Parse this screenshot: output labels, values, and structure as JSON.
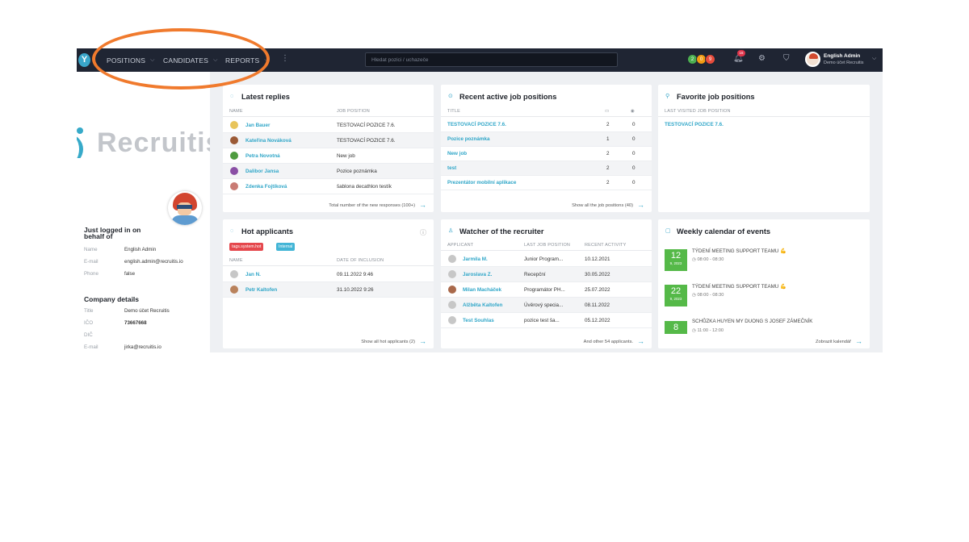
{
  "topbar": {
    "logo": "Y",
    "nav": [
      "POSITIONS",
      "CANDIDATES",
      "REPORTS"
    ],
    "search_placeholder": "Hledat pozici / uchazeče",
    "status_counts": [
      {
        "value": "2",
        "color": "#4caf50"
      },
      {
        "value": "0",
        "color": "#f39c12"
      },
      {
        "value": "9",
        "color": "#e74c3c"
      }
    ],
    "notifications_count": "16",
    "user_name": "English Admin",
    "user_org": "Demo účet Recruitis",
    "icons": [
      "bell-icon",
      "gear-icon",
      "shield-icon"
    ]
  },
  "sidebar": {
    "brand": "Recruitis",
    "login_heading": "Just logged in on behalf of",
    "login_rows": [
      {
        "label": "Name",
        "value": "English Admin"
      },
      {
        "label": "E-mail",
        "value": "english.admin@recruitis.io"
      },
      {
        "label": "Phone",
        "value": "false"
      }
    ],
    "company_heading": "Company details",
    "company_rows": [
      {
        "label": "Title",
        "value": "Demo účet Recruitis"
      },
      {
        "label": "IČO",
        "value": "73667668"
      },
      {
        "label": "DIČ",
        "value": ""
      },
      {
        "label": "E-mail",
        "value": "jirka@recruitis.io"
      }
    ]
  },
  "latest_replies": {
    "title": "Latest replies",
    "col_name": "NAME",
    "col_position": "JOB POSITION",
    "rows": [
      {
        "name": "Jan Bauer",
        "position": "TESTOVACÍ POZICE 7.6.",
        "avatar": "#e8c45a"
      },
      {
        "name": "Kateřina Nováková",
        "position": "TESTOVACÍ POZICE 7.6.",
        "avatar": "#9b5a36"
      },
      {
        "name": "Petra Novotná",
        "position": "New job",
        "avatar": "#4e9b3f"
      },
      {
        "name": "Dalibor Jansa",
        "position": "Pozice poznámka",
        "avatar": "#8a4fa5"
      },
      {
        "name": "Zdenka Fojtíková",
        "position": "šablona decathlon testík",
        "avatar": "#c97b74"
      }
    ],
    "footer": "Total number of the new responses (100+)"
  },
  "recent_positions": {
    "title": "Recent active job positions",
    "col_title": "TITLE",
    "rows": [
      {
        "title": "TESTOVACÍ POZICE 7.6.",
        "a": "2",
        "b": "0"
      },
      {
        "title": "Pozice poznámka",
        "a": "1",
        "b": "0"
      },
      {
        "title": "New job",
        "a": "2",
        "b": "0"
      },
      {
        "title": "test",
        "a": "2",
        "b": "0"
      },
      {
        "title": "Prezentátor mobilní aplikace",
        "a": "2",
        "b": "0"
      }
    ],
    "footer": "Show all the job positions (40)"
  },
  "favorite_positions": {
    "title": "Favorite job positions",
    "col": "LAST VISITED JOB POSITION",
    "rows": [
      "TESTOVACÍ POZICE 7.6."
    ]
  },
  "hot_applicants": {
    "title": "Hot applicants",
    "tags": [
      {
        "label": "tags.system.hot",
        "color": "#e5484d"
      },
      {
        "label": "Internal",
        "color": "#43b5d6"
      }
    ],
    "col_name": "NAME",
    "col_date": "DATE OF INCLUSION",
    "rows": [
      {
        "name": "Jan N.",
        "date": "09.11.2022 9:46",
        "avatar": "#c7c7c7"
      },
      {
        "name": "Petr Kaltofen",
        "date": "31.10.2022 9:26",
        "avatar": "#b9825c"
      }
    ],
    "footer": "Show all hot applicants (2)"
  },
  "watcher": {
    "title": "Watcher of the recruiter",
    "col_applicant": "APPLICANT",
    "col_position": "LAST JOB POSITION",
    "col_activity": "RECENT ACTIVITY",
    "rows": [
      {
        "name": "Jarmila M.",
        "position": "Junior Program...",
        "activity": "10.12.2021",
        "avatar": "#c7c7c7"
      },
      {
        "name": "Jaroslava Z.",
        "position": "Recepční",
        "activity": "30.05.2022",
        "avatar": "#c7c7c7"
      },
      {
        "name": "Milan Macháček",
        "position": "Programátor PH...",
        "activity": "25.07.2022",
        "avatar": "#a9694b"
      },
      {
        "name": "Alžběta Kaltofen",
        "position": "Úvěrový specia...",
        "activity": "08.11.2022",
        "avatar": "#c7c7c7"
      },
      {
        "name": "Test Souhlas",
        "position": "pozice test ša...",
        "activity": "05.12.2022",
        "avatar": "#c7c7c7"
      }
    ],
    "footer": "And other 54 applicants."
  },
  "calendar": {
    "title": "Weekly calendar of events",
    "events": [
      {
        "day": "12",
        "month": "9, 2023",
        "title": "TÝDENÍ MEETING SUPPORT TEAMU 💪",
        "time": "08:00 - 08:30"
      },
      {
        "day": "22",
        "month": "9, 2023",
        "title": "TÝDENÍ MEETING SUPPORT TEAMU 💪",
        "time": "08:00 - 08:30"
      },
      {
        "day": "8",
        "month": "",
        "title": "SCHŮZKA HUYEN MY DUONG S JOSEF ZÁMEČNÍK",
        "time": "11:00 - 12:00"
      }
    ],
    "footer": "Zobrazit kalendář"
  }
}
